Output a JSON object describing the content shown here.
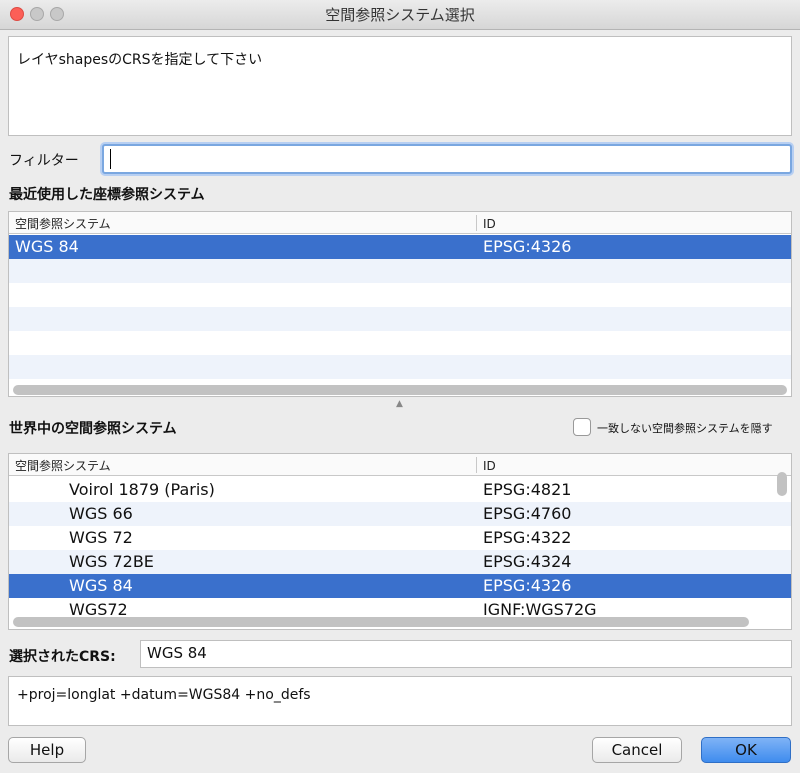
{
  "window": {
    "title": "空間参照システム選択"
  },
  "message": "レイヤshapesのCRSを指定して下さい",
  "filter": {
    "label": "フィルター",
    "value": ""
  },
  "recent": {
    "heading": "最近使用した座標参照システム",
    "columns": [
      "空間参照システム",
      "ID"
    ],
    "rows": [
      {
        "name": "WGS 84",
        "id": "EPSG:4326",
        "selected": true
      }
    ]
  },
  "world": {
    "heading": "世界中の空間参照システム",
    "hide_label": "一致しない空間参照システムを隠す",
    "hide_checked": false,
    "columns": [
      "空間参照システム",
      "ID"
    ],
    "rows": [
      {
        "name": "Voirol 1879 (Paris)",
        "id": "EPSG:4821",
        "selected": false
      },
      {
        "name": "WGS 66",
        "id": "EPSG:4760",
        "selected": false
      },
      {
        "name": "WGS 72",
        "id": "EPSG:4322",
        "selected": false
      },
      {
        "name": "WGS 72BE",
        "id": "EPSG:4324",
        "selected": false
      },
      {
        "name": "WGS 84",
        "id": "EPSG:4326",
        "selected": true
      },
      {
        "name": "WGS72",
        "id": "IGNF:WGS72G",
        "selected": false
      }
    ]
  },
  "selected_crs": {
    "label": "選択されたCRS:",
    "value": "WGS 84"
  },
  "proj_string": "+proj=longlat +datum=WGS84 +no_defs",
  "buttons": {
    "help": "Help",
    "cancel": "Cancel",
    "ok": "OK"
  },
  "colors": {
    "selection": "#3a70cc",
    "alt_row": "#eef3fb",
    "ok_button": "#3f8cee"
  }
}
